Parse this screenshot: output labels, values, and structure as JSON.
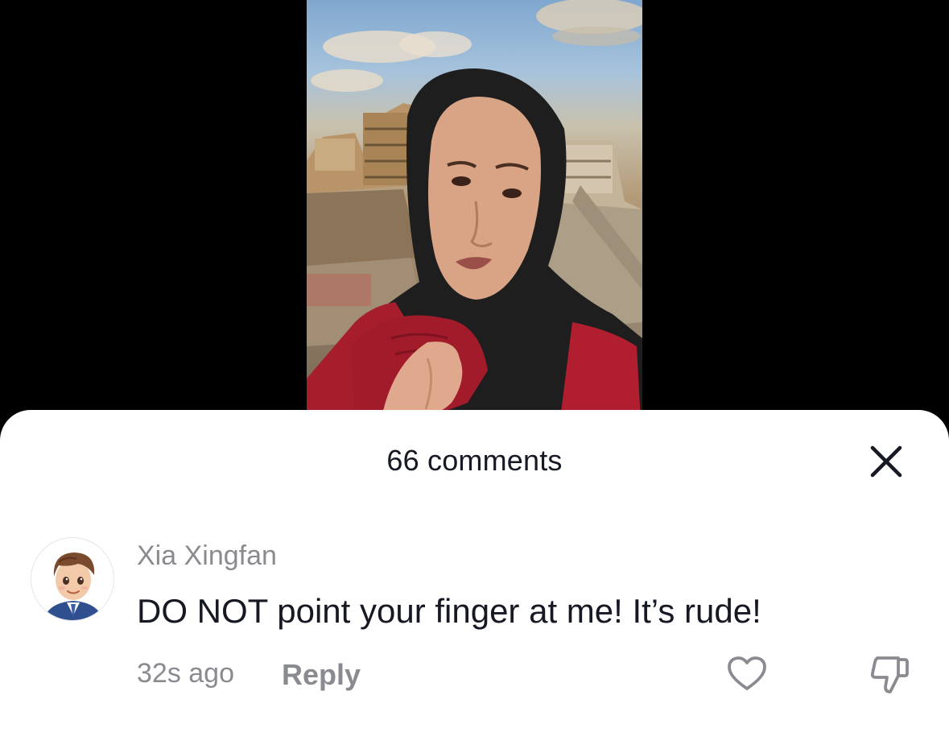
{
  "sheet": {
    "title": "66 comments"
  },
  "comments": [
    {
      "username": "Xia Xingfan",
      "text": "DO NOT point your finger at me! It’s rude!",
      "timestamp": "32s ago",
      "reply_label": "Reply"
    }
  ],
  "icons": {
    "close": "close-icon",
    "like": "heart-icon",
    "dislike": "thumbs-down-icon"
  },
  "colors": {
    "sheet_background": "#ffffff",
    "primary_text": "#161823",
    "secondary_text": "#8a8b91",
    "backdrop": "#000000"
  }
}
